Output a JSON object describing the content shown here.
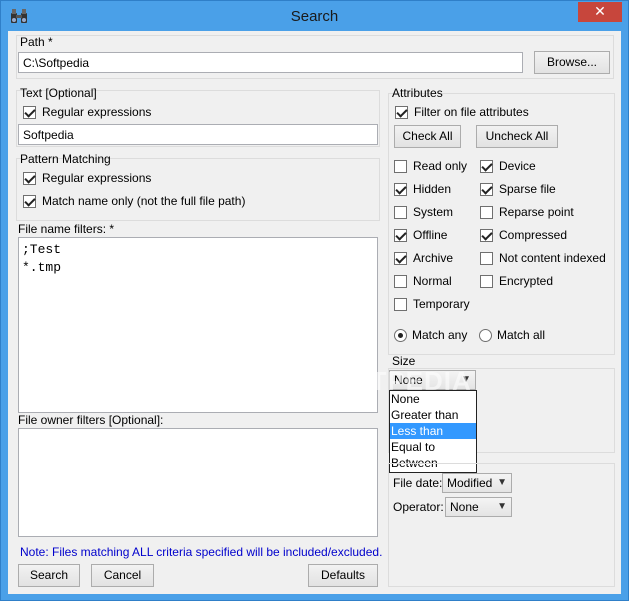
{
  "window": {
    "title": "Search",
    "close_label": "✕"
  },
  "path": {
    "label": "Path *",
    "value": "C:\\Softpedia",
    "browse_label": "Browse..."
  },
  "text": {
    "label": "Text [Optional]",
    "regex_label": "Regular expressions",
    "value": "Softpedia"
  },
  "pattern": {
    "label": "Pattern Matching",
    "regex_label": "Regular expressions",
    "name_only_label": "Match name only (not the full file path)"
  },
  "file_name_filters": {
    "label": "File name filters: *",
    "lines": [
      ";Test",
      "*.tmp"
    ]
  },
  "file_owner_filters": {
    "label": "File owner filters [Optional]:"
  },
  "note": "Note: Files matching ALL criteria specified will be included/excluded.",
  "buttons": {
    "search": "Search",
    "cancel": "Cancel",
    "defaults": "Defaults"
  },
  "attributes": {
    "label": "Attributes",
    "filter_label": "Filter on file attributes",
    "check_all": "Check All",
    "uncheck_all": "Uncheck All",
    "left": [
      {
        "label": "Read only",
        "checked": false
      },
      {
        "label": "Hidden",
        "checked": true
      },
      {
        "label": "System",
        "checked": false
      },
      {
        "label": "Offline",
        "checked": true
      },
      {
        "label": "Archive",
        "checked": true
      },
      {
        "label": "Normal",
        "checked": false
      },
      {
        "label": "Temporary",
        "checked": false
      }
    ],
    "right": [
      {
        "label": "Device",
        "checked": true
      },
      {
        "label": "Sparse file",
        "checked": true
      },
      {
        "label": "Reparse point",
        "checked": false
      },
      {
        "label": "Compressed",
        "checked": true
      },
      {
        "label": "Not content indexed",
        "checked": false
      },
      {
        "label": "Encrypted",
        "checked": false
      }
    ],
    "match_any": "Match any",
    "match_all": "Match all"
  },
  "size": {
    "label": "Size",
    "selected": "None",
    "options": [
      "None",
      "Greater than",
      "Less than",
      "Equal to",
      "Between"
    ],
    "highlighted": "Less than"
  },
  "date": {
    "file_date_label": "File date:",
    "file_date_value": "Modified",
    "operator_label": "Operator:",
    "operator_value": "None"
  },
  "watermark": "SOFTPEDIA"
}
